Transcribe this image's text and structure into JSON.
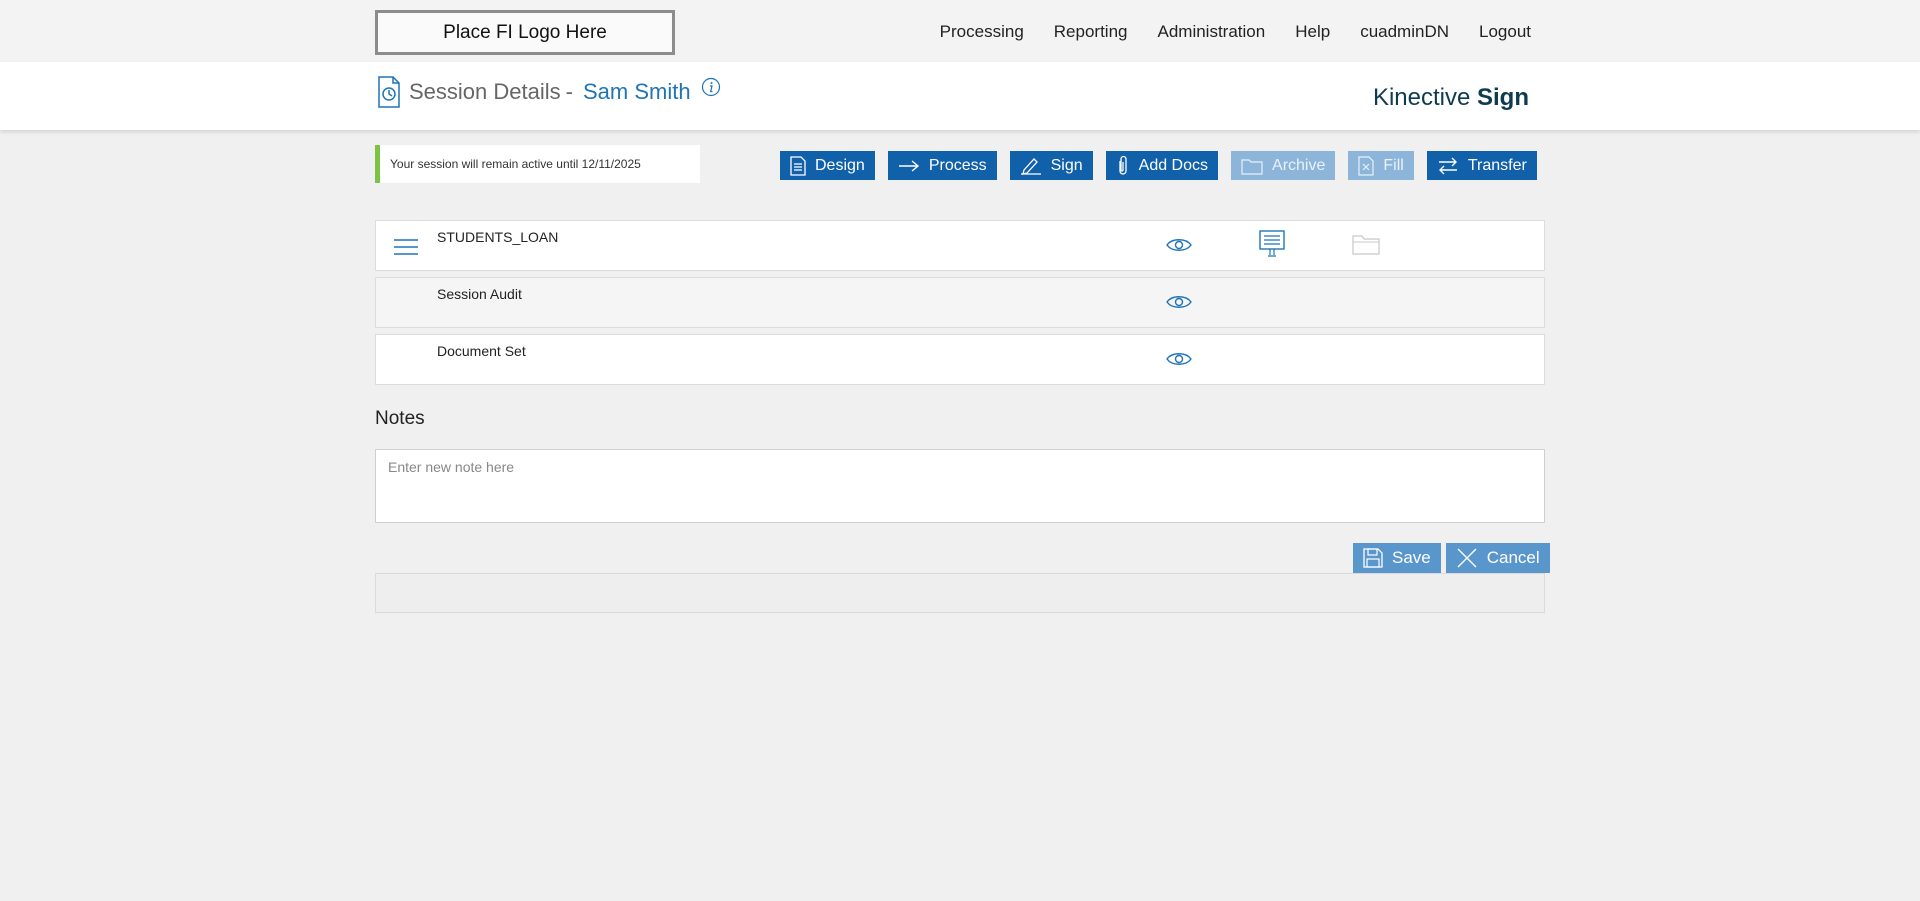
{
  "top_nav": {
    "logo_text": "Place FI Logo Here",
    "items": [
      "Processing",
      "Reporting",
      "Administration",
      "Help",
      "cuadminDN",
      "Logout"
    ]
  },
  "header": {
    "title": "Session Details",
    "separator": "-",
    "user_name": "Sam Smith",
    "brand_light": "Kinective",
    "brand_bold": "Sign"
  },
  "session_notice": "Your session will remain active until 12/11/2025",
  "actions": [
    {
      "label": "Design",
      "icon": "document-list-icon",
      "enabled": true
    },
    {
      "label": "Process",
      "icon": "arrow-right-icon",
      "enabled": true
    },
    {
      "label": "Sign",
      "icon": "pen-icon",
      "enabled": true
    },
    {
      "label": "Add Docs",
      "icon": "paperclip-icon",
      "enabled": true
    },
    {
      "label": "Archive",
      "icon": "folder-icon",
      "enabled": false
    },
    {
      "label": "Fill",
      "icon": "form-icon",
      "enabled": false
    },
    {
      "label": "Transfer",
      "icon": "transfer-arrows-icon",
      "enabled": true
    }
  ],
  "documents": [
    {
      "name": "STUDENTS_LOAN",
      "icons": [
        "menu-icon",
        "eye-icon",
        "monitor-icon",
        "folder-icon"
      ]
    },
    {
      "name": "Session Audit",
      "icons": [
        "eye-icon"
      ]
    },
    {
      "name": "Document Set",
      "icons": [
        "eye-icon"
      ]
    }
  ],
  "notes": {
    "heading": "Notes",
    "placeholder": "Enter new note here",
    "save_label": "Save",
    "cancel_label": "Cancel"
  },
  "colors": {
    "primary_button": "#1060aa",
    "disabled_button": "#8db5d9",
    "link_blue": "#1f74b8",
    "notice_accent": "#7cc243",
    "brand_text": "#0e3b4f"
  }
}
